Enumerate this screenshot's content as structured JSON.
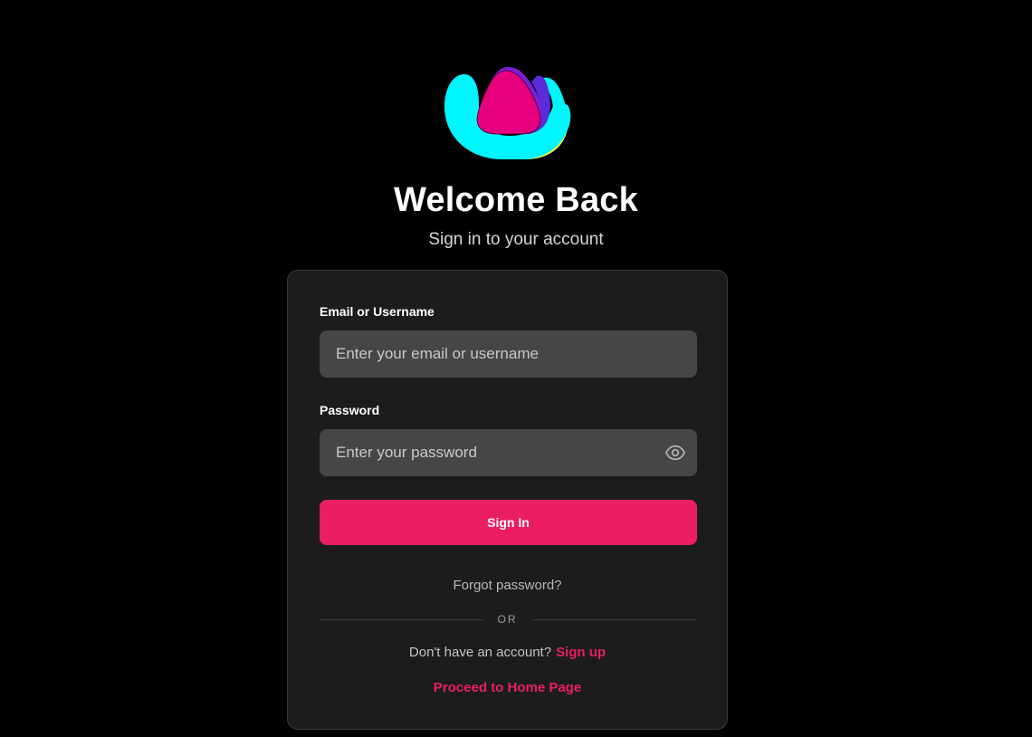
{
  "header": {
    "title": "Welcome Back",
    "subtitle": "Sign in to your account"
  },
  "logo": {
    "icon": "brand-logo-icon",
    "colors": {
      "cyan": "#00f5ff",
      "magenta": "#e6007e",
      "purple": "#8a2be2",
      "yellow": "#f4ff3d"
    }
  },
  "form": {
    "email_label": "Email or Username",
    "email_placeholder": "Enter your email or username",
    "email_value": "",
    "password_label": "Password",
    "password_placeholder": "Enter your password",
    "password_value": "",
    "password_toggle_icon": "eye-icon",
    "submit_label": "Sign In"
  },
  "links": {
    "forgot": "Forgot password?",
    "divider_text": "OR",
    "signup_prompt": "Don't have an account?",
    "signup_link": "Sign up",
    "proceed": "Proceed to Home Page"
  },
  "theme": {
    "accent": "#e91e63",
    "background": "#000000",
    "card": "#1c1c1e",
    "input": "#464646"
  }
}
